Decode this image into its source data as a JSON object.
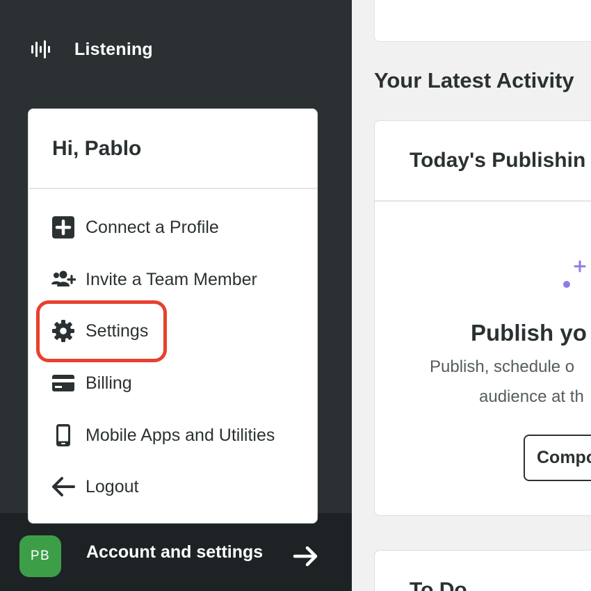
{
  "sidebar": {
    "nav": {
      "label": "Listening",
      "icon": "waveform-icon"
    },
    "menu": {
      "greeting": "Hi, Pablo",
      "items": [
        {
          "label": "Connect a Profile",
          "icon": "plus-square-icon"
        },
        {
          "label": "Invite a Team Member",
          "icon": "users-plus-icon"
        },
        {
          "label": "Settings",
          "icon": "gear-icon"
        },
        {
          "label": "Billing",
          "icon": "credit-card-icon"
        },
        {
          "label": "Mobile Apps and Utilities",
          "icon": "mobile-phone-icon"
        },
        {
          "label": "Logout",
          "icon": "arrow-left-icon"
        }
      ]
    },
    "account": {
      "avatar_initials": "PB",
      "label": "Account and settings",
      "icon": "arrow-right-icon",
      "avatar_color": "#3d9e48"
    }
  },
  "main": {
    "section_title": "Your Latest Activity",
    "publishing_card": {
      "title": "Today's Publishin",
      "empty_title": "Publish yo",
      "empty_line1": "Publish, schedule o",
      "empty_line2": "audience at th",
      "button_label": "Compo"
    },
    "todo_card": {
      "title": "To Do"
    }
  },
  "colors": {
    "sidebar_bg": "#2b3133",
    "highlight": "#e8402e",
    "accent_purple": "#8f7be8"
  }
}
